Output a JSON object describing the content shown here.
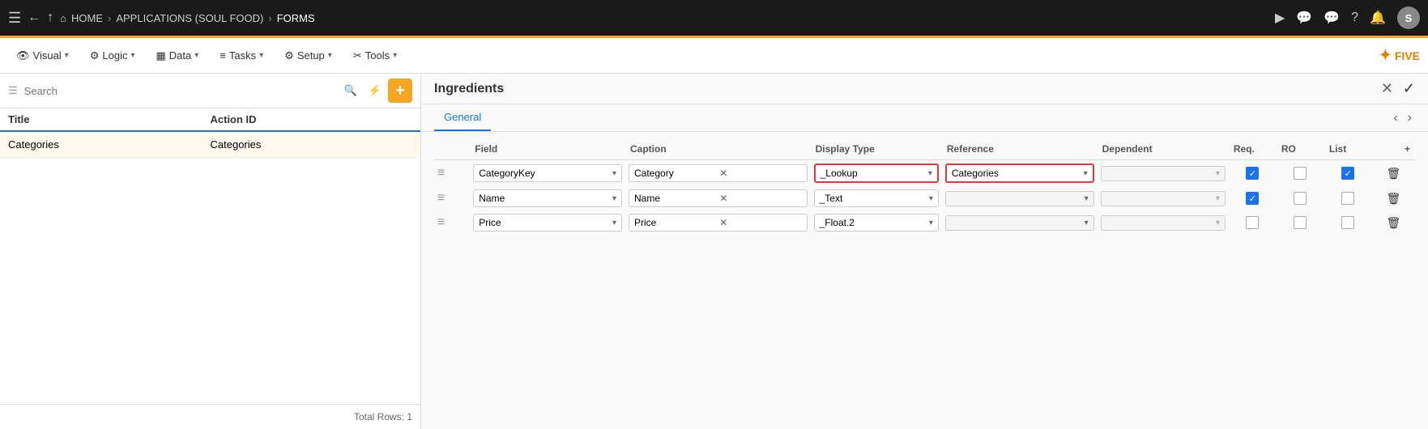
{
  "topNav": {
    "hamburger": "☰",
    "backIcon": "←",
    "upIcon": "↑",
    "homeIcon": "⌂",
    "breadcrumbs": [
      {
        "label": "HOME",
        "sep": ">"
      },
      {
        "label": "APPLICATIONS (SOUL FOOD)",
        "sep": ">"
      },
      {
        "label": "FORMS",
        "sep": ""
      }
    ],
    "rightIcons": [
      "▶",
      "💬",
      "💬",
      "?",
      "🔔"
    ],
    "avatar": "S"
  },
  "toolbar": {
    "visual": "Visual",
    "logic": "Logic",
    "data": "Data",
    "tasks": "Tasks",
    "setup": "Setup",
    "tools": "Tools",
    "fiveLogo": "FIVE"
  },
  "leftPanel": {
    "searchPlaceholder": "Search",
    "tableHeaders": [
      "Title",
      "Action ID"
    ],
    "rows": [
      {
        "title": "Categories",
        "actionId": "Categories"
      }
    ],
    "totalRows": "Total Rows: 1"
  },
  "rightPanel": {
    "title": "Ingredients",
    "tabs": [
      {
        "label": "General",
        "active": true
      }
    ],
    "columns": {
      "field": "Field",
      "caption": "Caption",
      "displayType": "Display Type",
      "reference": "Reference",
      "dependent": "Dependent",
      "req": "Req.",
      "ro": "RO",
      "list": "List"
    },
    "rows": [
      {
        "handle": "≡",
        "field": "CategoryKey",
        "caption": "Category",
        "displayType": "_Lookup",
        "reference": "Categories",
        "dependent": "",
        "req": true,
        "ro": false,
        "list": true,
        "displayHighlight": true,
        "refHighlight": true
      },
      {
        "handle": "≡",
        "field": "Name",
        "caption": "Name",
        "displayType": "_Text",
        "reference": "",
        "dependent": "",
        "req": true,
        "ro": false,
        "list": false,
        "displayHighlight": false,
        "refHighlight": false
      },
      {
        "handle": "≡",
        "field": "Price",
        "caption": "Price",
        "displayType": "_Float.2",
        "reference": "",
        "dependent": "",
        "req": false,
        "ro": false,
        "list": false,
        "displayHighlight": false,
        "refHighlight": false
      }
    ]
  }
}
